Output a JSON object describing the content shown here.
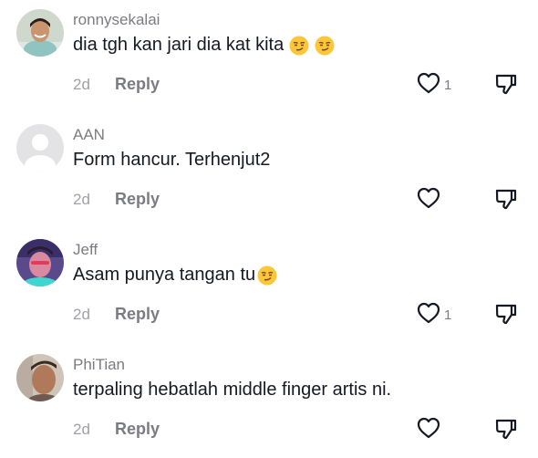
{
  "comments": [
    {
      "username": "ronnysekalai",
      "text": "dia tgh kan jari dia kat kita",
      "emojis": [
        "smirk-emoji",
        "smirk-emoji"
      ],
      "time": "2d",
      "reply_label": "Reply",
      "like_count": "1"
    },
    {
      "username": "AAN",
      "text": "Form hancur. Terhenjut2",
      "emojis": [],
      "time": "2d",
      "reply_label": "Reply",
      "like_count": ""
    },
    {
      "username": "Jeff",
      "text": "Asam punya tangan tu",
      "emojis": [
        "smirk-emoji"
      ],
      "time": "2d",
      "reply_label": "Reply",
      "like_count": "1"
    },
    {
      "username": "PhiTian",
      "text": "terpaling hebatlah middle finger artis ni.",
      "emojis": [],
      "time": "2d",
      "reply_label": "Reply",
      "like_count": ""
    }
  ],
  "icons": {
    "like": "heart-outline-icon",
    "dislike": "thumbs-down-outline-icon"
  },
  "colors": {
    "text": "#161823",
    "secondary": "#7b7b83",
    "muted": "#a0a0a8"
  }
}
